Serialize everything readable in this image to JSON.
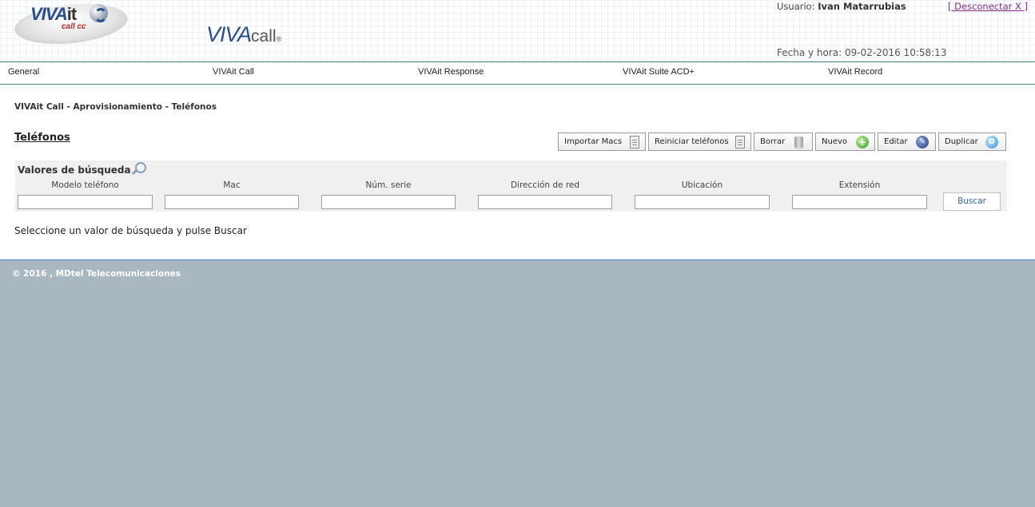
{
  "header": {
    "brand_main": "VIVA",
    "brand_it": "it",
    "brand_sub": "call cc",
    "product_bold": "VIVA",
    "product_rest": "call",
    "product_mark": "®",
    "user_label": "Usuario:",
    "user_name": "Ivan Matarrubias",
    "logout_label": "[ Desconectar X ]",
    "datetime_label": "Fecha y hora: 09-02-2016 10:58:13"
  },
  "nav": {
    "items": [
      "General",
      "VIVAit Call",
      "VIVAit Response",
      "VIVAit Suite ACD+",
      "VIVAit Record"
    ]
  },
  "main": {
    "breadcrumb": "VIVAit Call - Aprovisionamiento - Teléfonos",
    "title": "Teléfonos",
    "toolbar": [
      {
        "label": "Importar Macs",
        "icon": "document-icon"
      },
      {
        "label": "Reiniciar teléfonos",
        "icon": "document-icon"
      },
      {
        "label": "Borrar",
        "icon": "trash-icon"
      },
      {
        "label": "Nuevo",
        "icon": "plus-icon"
      },
      {
        "label": "Editar",
        "icon": "pen-icon"
      },
      {
        "label": "Duplicar",
        "icon": "duplicate-icon"
      }
    ],
    "search": {
      "title": "Valores de búsqueda",
      "columns": [
        "Modelo teléfono",
        "Mac",
        "Núm. serie",
        "Dirección de red",
        "Ubicación",
        "Extensión"
      ],
      "values": [
        "",
        "",
        "",
        "",
        "",
        ""
      ],
      "button_label": "Buscar"
    },
    "hint": "Seleccione un valor de búsqueda y pulse Buscar"
  },
  "footer": {
    "copyright": "© 2016 , MDtel Telecomunicaciones"
  },
  "colors": {
    "nav_border": "#4a7e8e",
    "footer_bg": "#a9b8c0",
    "brand_blue": "#2a4d8f"
  }
}
